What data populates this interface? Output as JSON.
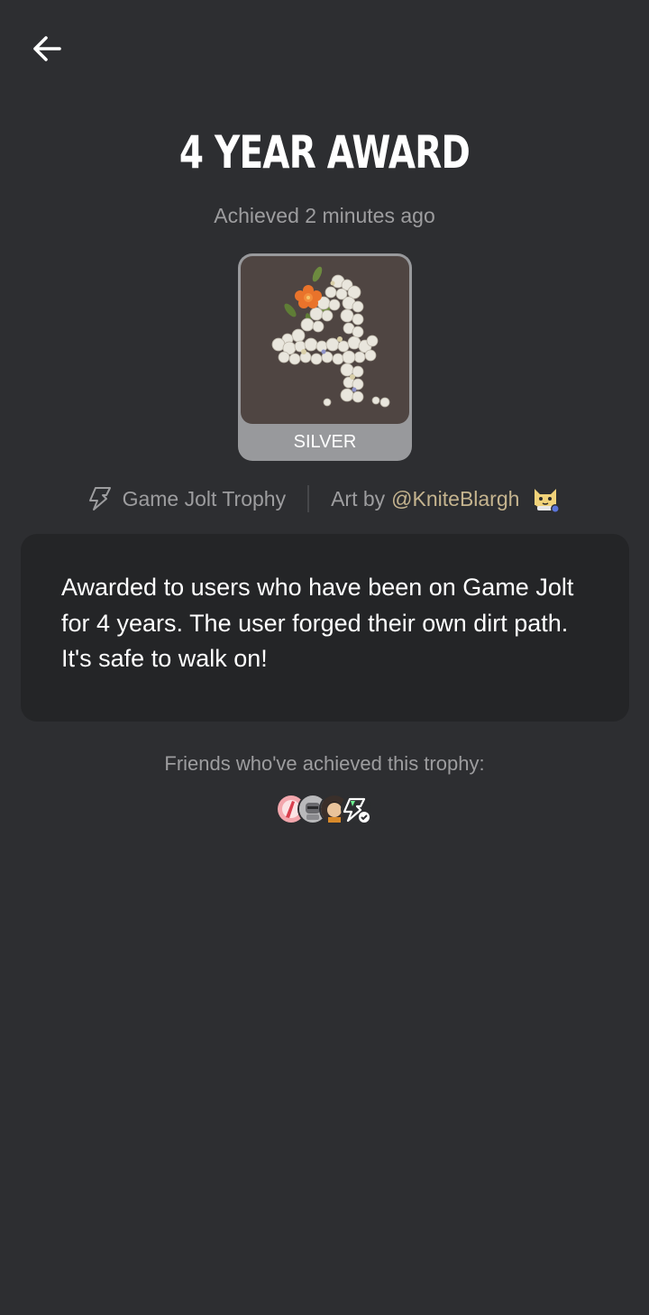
{
  "header": {
    "back_icon": "arrow-left-icon"
  },
  "trophy": {
    "title": "4 YEAR AWARD",
    "achieved": "Achieved 2 minutes ago",
    "tier": "SILVER",
    "image_icon": "pearl-number-four-with-flower",
    "source_label": "Game Jolt Trophy",
    "source_icon": "game-jolt-bolt-icon",
    "art_by_prefix": "Art by",
    "artist": "@KniteBlargh",
    "artist_avatar_icon": "cat-avatar",
    "description": "Awarded to users who have been on Game Jolt for 4 years. The user forged their own dirt path. It's safe to walk on!"
  },
  "friends": {
    "label": "Friends who've achieved this trophy:",
    "avatars": [
      "friend-avatar-pink",
      "friend-avatar-robot",
      "friend-avatar-anime",
      "friend-avatar-gamejolt"
    ]
  },
  "colors": {
    "background": "#2d2e31",
    "card": "#242527",
    "muted_text": "#9d9d9f",
    "artist_link": "#c5b48f",
    "silver": "#98999c"
  }
}
